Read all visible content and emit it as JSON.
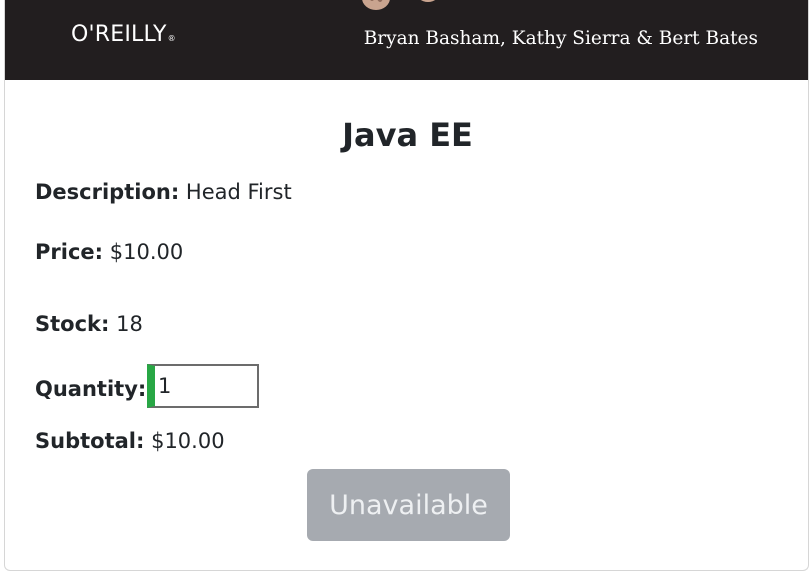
{
  "cover": {
    "publisher_logo": "O'REILLY",
    "logo_mark": "®",
    "authors": "Bryan Basham, Kathy Sierra & Bert Bates"
  },
  "product": {
    "title": "Java EE",
    "description_label": "Description:",
    "description": "Head First",
    "price_label": "Price:",
    "price": "$10.00",
    "stock_label": "Stock:",
    "stock": "18",
    "quantity_label": "Quantity:",
    "quantity": "1",
    "subtotal_label": "Subtotal:",
    "subtotal": "$10.00"
  },
  "actions": {
    "button_label": "Unavailable",
    "button_state": "disabled"
  },
  "colors": {
    "cover_bg": "#221e1f",
    "input_valid_accent": "#28a745",
    "button_disabled_bg": "#a6aab0"
  }
}
